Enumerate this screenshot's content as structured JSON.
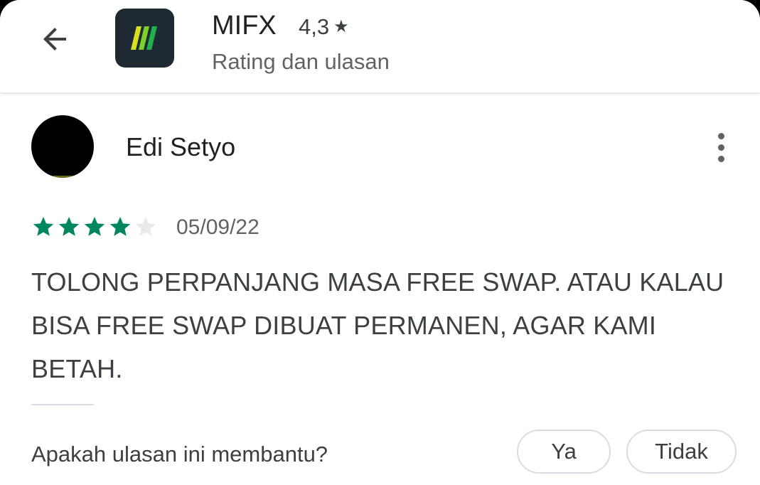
{
  "header": {
    "back_icon": "arrow-left-icon",
    "app_name": "MIFX",
    "rating": "4,3",
    "rating_icon": "star-icon",
    "subtitle": "Rating dan ulasan"
  },
  "review": {
    "reviewer_name": "Edi Setyo",
    "more_icon": "more-vertical-icon",
    "stars_filled": 4,
    "stars_total": 5,
    "date": "05/09/22",
    "text": "TOLONG PERPANJANG MASA FREE SWAP. ATAU KALAU BISA FREE SWAP DIBUAT PERMANEN, AGAR KAMI BETAH."
  },
  "helpful": {
    "question": "Apakah ulasan ini membantu?",
    "yes_label": "Ya",
    "no_label": "Tidak"
  },
  "colors": {
    "star_filled": "#01875f",
    "star_empty": "#e8eaed",
    "app_icon_bg": "#1e2a33",
    "text_primary": "#202124",
    "text_secondary": "#5f6368"
  }
}
